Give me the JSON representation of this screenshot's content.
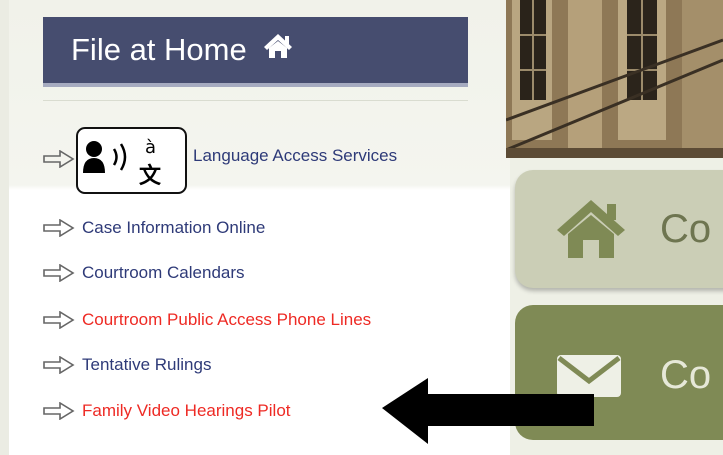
{
  "header": {
    "title": "File at Home",
    "icon": "home-icon"
  },
  "language_access": {
    "label": "Language Access Services",
    "icon": "language-translate-icon"
  },
  "links": [
    {
      "label": "Case Information Online",
      "color": "#2e3a78"
    },
    {
      "label": "Courtroom Calendars",
      "color": "#2e3a78"
    },
    {
      "label": "Courtroom Public Access Phone Lines",
      "color": "#ee2a24"
    },
    {
      "label": "Tentative Rulings",
      "color": "#2e3a78"
    },
    {
      "label": "Family Video Hearings Pilot",
      "color": "#ee2a24"
    }
  ],
  "tiles": [
    {
      "label": "Co",
      "icon": "home-icon",
      "bg": "#cbceb6"
    },
    {
      "label": "Co",
      "icon": "envelope-icon",
      "bg": "#7f8a55"
    }
  ],
  "colors": {
    "header_bg": "#464d6f",
    "link_blue": "#2e3a78",
    "link_red": "#ee2a24",
    "arrow": "#000000"
  }
}
